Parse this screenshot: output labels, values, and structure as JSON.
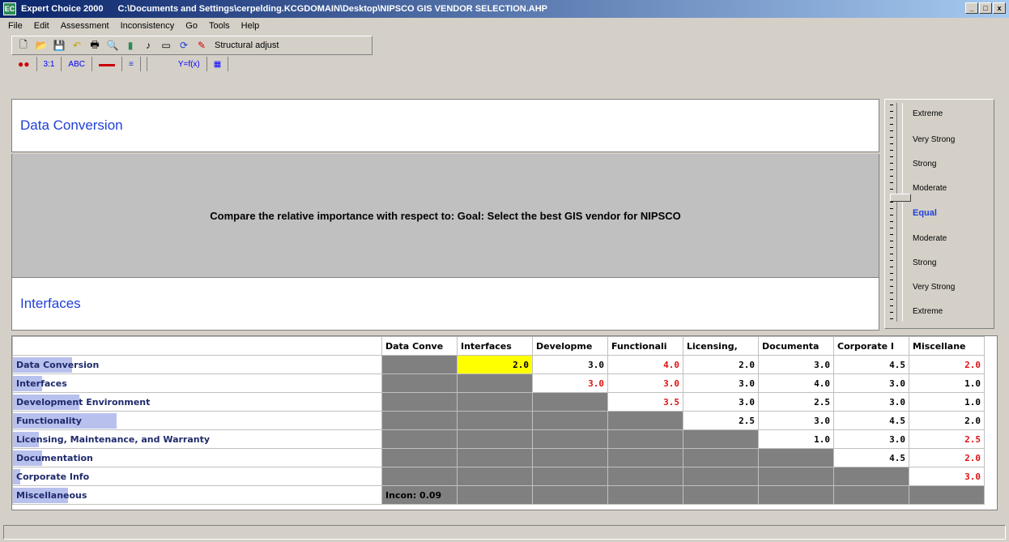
{
  "window": {
    "app_name": "Expert Choice 2000",
    "path": "C:\\Documents and Settings\\cerpelding.KCGDOMAIN\\Desktop\\NIPSCO GIS VENDOR SELECTION.AHP",
    "minimize": "_",
    "maximize": "□",
    "close": "x"
  },
  "menu": [
    "File",
    "Edit",
    "Assessment",
    "Inconsistency",
    "Go",
    "Tools",
    "Help"
  ],
  "toolbar": {
    "structural_adjust": "Structural adjust"
  },
  "mode_tabs": [
    "3:1",
    "ABC",
    "Y=f(x)"
  ],
  "compare": {
    "top_element": "Data Conversion",
    "question": "Compare the relative importance  with respect to: Goal: Select the best GIS vendor for NIPSCO",
    "bottom_element": "Interfaces"
  },
  "scale": {
    "labels": [
      "Extreme",
      "Very Strong",
      "Strong",
      "Moderate",
      "Equal",
      "Moderate",
      "Strong",
      "Very Strong",
      "Extreme"
    ]
  },
  "matrix": {
    "columns": [
      "Data Conve",
      "Interfaces",
      "Developme",
      "Functionali",
      "Licensing,",
      "Documenta",
      "Corporate I",
      "Miscellane"
    ],
    "rows": [
      {
        "label": "Data Conversion",
        "bar_fraction": 0.16,
        "cells": [
          "",
          "2.0",
          "3.0",
          "4.0",
          "2.0",
          "3.0",
          "4.5",
          "2.0"
        ]
      },
      {
        "label": "Interfaces",
        "bar_fraction": 0.08,
        "cells": [
          "",
          "",
          "3.0",
          "3.0",
          "3.0",
          "4.0",
          "3.0",
          "1.0"
        ]
      },
      {
        "label": "Development Environment",
        "bar_fraction": 0.18,
        "cells": [
          "",
          "",
          "",
          "3.5",
          "3.0",
          "2.5",
          "3.0",
          "1.0"
        ]
      },
      {
        "label": "Functionality",
        "bar_fraction": 0.28,
        "cells": [
          "",
          "",
          "",
          "",
          "2.5",
          "3.0",
          "4.5",
          "2.0"
        ]
      },
      {
        "label": "Licensing, Maintenance, and Warranty",
        "bar_fraction": 0.07,
        "cells": [
          "",
          "",
          "",
          "",
          "",
          "1.0",
          "3.0",
          "2.5"
        ]
      },
      {
        "label": "Documentation",
        "bar_fraction": 0.08,
        "cells": [
          "",
          "",
          "",
          "",
          "",
          "",
          "4.5",
          "2.0"
        ]
      },
      {
        "label": "Corporate Info",
        "bar_fraction": 0.02,
        "cells": [
          "",
          "",
          "",
          "",
          "",
          "",
          "",
          "3.0"
        ]
      },
      {
        "label": "Miscellaneous",
        "bar_fraction": 0.15,
        "cells": [
          "",
          "",
          "",
          "",
          "",
          "",
          "",
          ""
        ]
      }
    ],
    "red_cells": [
      "0-3",
      "0-7",
      "1-2",
      "1-3",
      "2-3",
      "4-7",
      "5-7",
      "6-7"
    ],
    "selected_cell": "0-1",
    "inconsistency": "Incon: 0.09"
  }
}
